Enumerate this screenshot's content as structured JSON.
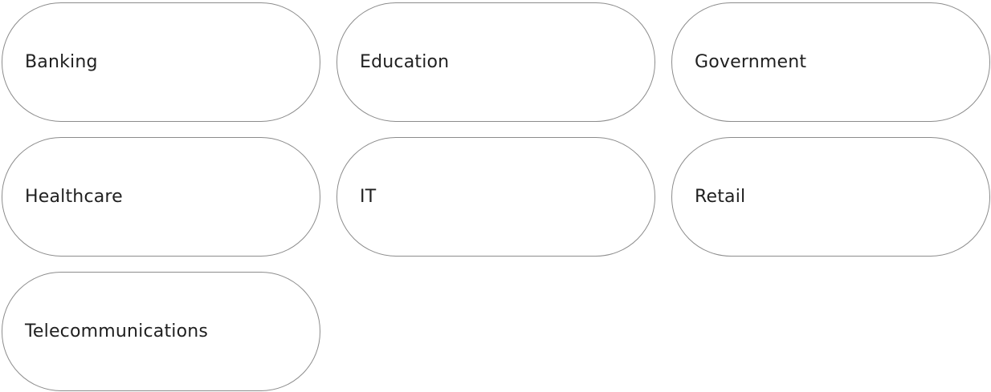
{
  "industries": [
    {
      "label": "Banking"
    },
    {
      "label": "Education"
    },
    {
      "label": "Government"
    },
    {
      "label": "Healthcare"
    },
    {
      "label": "IT"
    },
    {
      "label": "Retail"
    },
    {
      "label": "Telecommunications"
    }
  ],
  "colors": {
    "border": "#8c8c8c",
    "text": "#1f1f1f",
    "background": "#ffffff"
  }
}
